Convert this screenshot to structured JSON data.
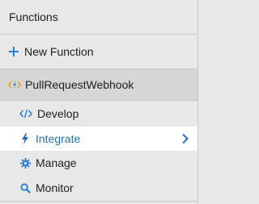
{
  "header": {
    "title": "Functions"
  },
  "new_function": {
    "label": "New Function",
    "icon": "plus-icon"
  },
  "function_item": {
    "name": "PullRequestWebhook",
    "icon": "function-code-icon"
  },
  "menu": {
    "items": [
      {
        "label": "Develop",
        "icon": "code-icon"
      },
      {
        "label": "Integrate",
        "icon": "lightning-icon",
        "selected": true
      },
      {
        "label": "Manage",
        "icon": "gear-icon"
      },
      {
        "label": "Monitor",
        "icon": "search-icon"
      }
    ]
  },
  "colors": {
    "accent": "#1f6fc0",
    "selected_bg": "#ffffff",
    "function_bg": "#d6d6d6",
    "panel_bg": "#e8e8e8"
  }
}
